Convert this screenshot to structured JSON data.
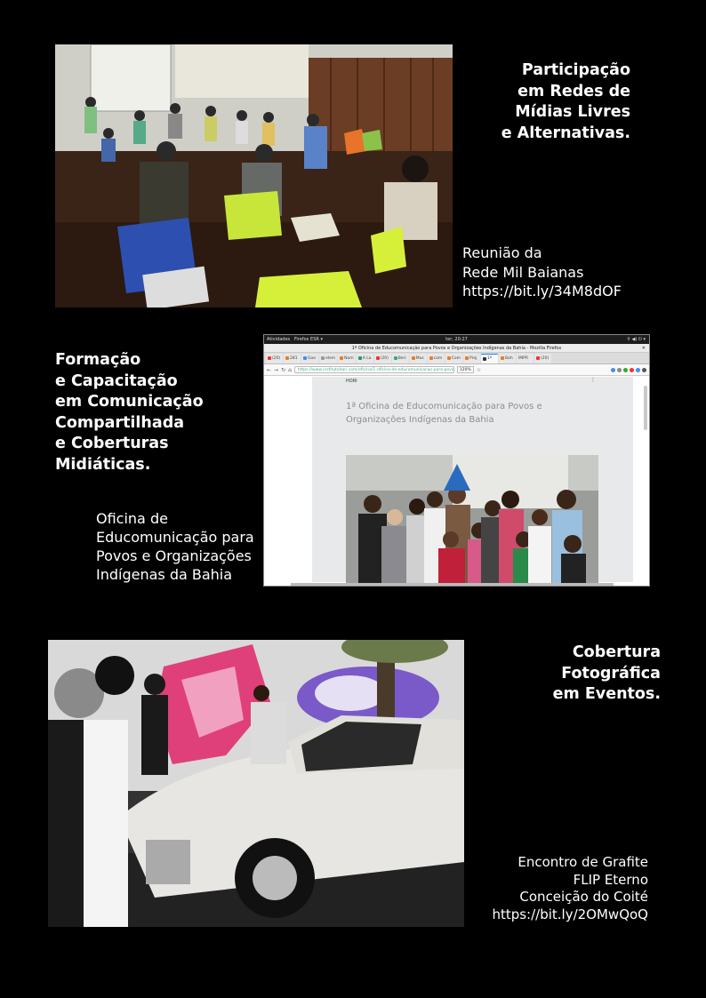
{
  "sections": [
    {
      "heading": [
        "Participação",
        "em Redes de",
        "Mídias Livres",
        "e Alternativas."
      ],
      "caption": [
        "Reunião da",
        "Rede Mil Baianas",
        "https://bit.ly/34M8dOF"
      ]
    },
    {
      "heading": [
        "Formação",
        "e Capacitação",
        "em Comunicação",
        "Compartilhada",
        "e Coberturas",
        "Midiáticas."
      ],
      "caption": [
        "Oficina de",
        "Educomunicação para",
        "Povos e Organizações",
        "Indígenas da Bahia"
      ]
    },
    {
      "heading": [
        "Cobertura",
        "Fotográfica",
        "em Eventos."
      ],
      "caption": [
        "Encontro de Grafite",
        "FLIP Eterno",
        "Conceição do Coité",
        "https://bit.ly/2OMwQoQ"
      ]
    }
  ],
  "browser": {
    "activities": "Atividades",
    "app_name": "Firefox ESR ▾",
    "clock": "ter, 20:27",
    "tray": "⚲ ◀) ⏻ ▾",
    "window_title": "1ª Oficina de Educomunicação para Povos e Organizações Indígenas da Bahia - Mozilla Firefox",
    "tabs": [
      "(20)",
      "281",
      "Goo",
      "elem",
      "Nom",
      "A La",
      "(20)",
      "Beri",
      "Mus",
      "cam",
      "Com",
      "Proj",
      "1º",
      "Bah",
      "IMPR",
      "(20)"
    ],
    "url": "https://www.institutohori.com/oficina/1-oficina-de-educomunicacao-para-povos-e",
    "zoom": "120%",
    "site_name": "HORI",
    "article_title": "1ª Oficina de Educomunicação para Povos e Organizações Indígenas da Bahia"
  },
  "colors": {
    "page_bg": "#000000",
    "text": "#ffffff",
    "accent": "#0a84ff"
  }
}
